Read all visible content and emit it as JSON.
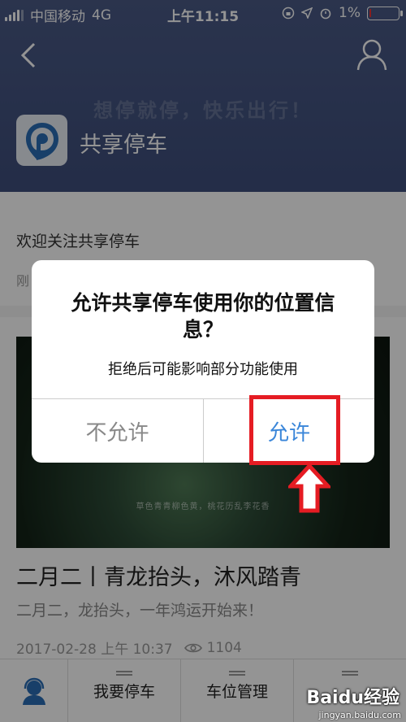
{
  "status_bar": {
    "carrier": "中国移动",
    "network": "4G",
    "time": "上午11:15",
    "battery": "1%"
  },
  "header": {
    "slogan": "想停就停，快乐出行！",
    "brand_name": "共享停车"
  },
  "welcome": {
    "title": "欢迎关注共享停车",
    "subtitle": "刚"
  },
  "article": {
    "image_caption": "草色青青柳色黄，桃花历乱李花香",
    "title": "二月二丨青龙抬头，沐风踏青",
    "summary": "二月二，龙抬头，一年鸿运开始来！",
    "date": "2017-02-28 上午 10:37",
    "views": "1104"
  },
  "tabbar": {
    "tab1": "我要停车",
    "tab2": "车位管理"
  },
  "dialog": {
    "title": "允许共享停车使用你的位置信息？",
    "message": "拒绝后可能影响部分功能使用",
    "deny": "不允许",
    "allow": "允许"
  },
  "watermark": {
    "text": "Baidu经验",
    "url": "jingyan.baidu.com"
  },
  "colors": {
    "header": "#3e4e7c",
    "allow_button": "#3a86d9",
    "annotation": "#e51c23"
  }
}
